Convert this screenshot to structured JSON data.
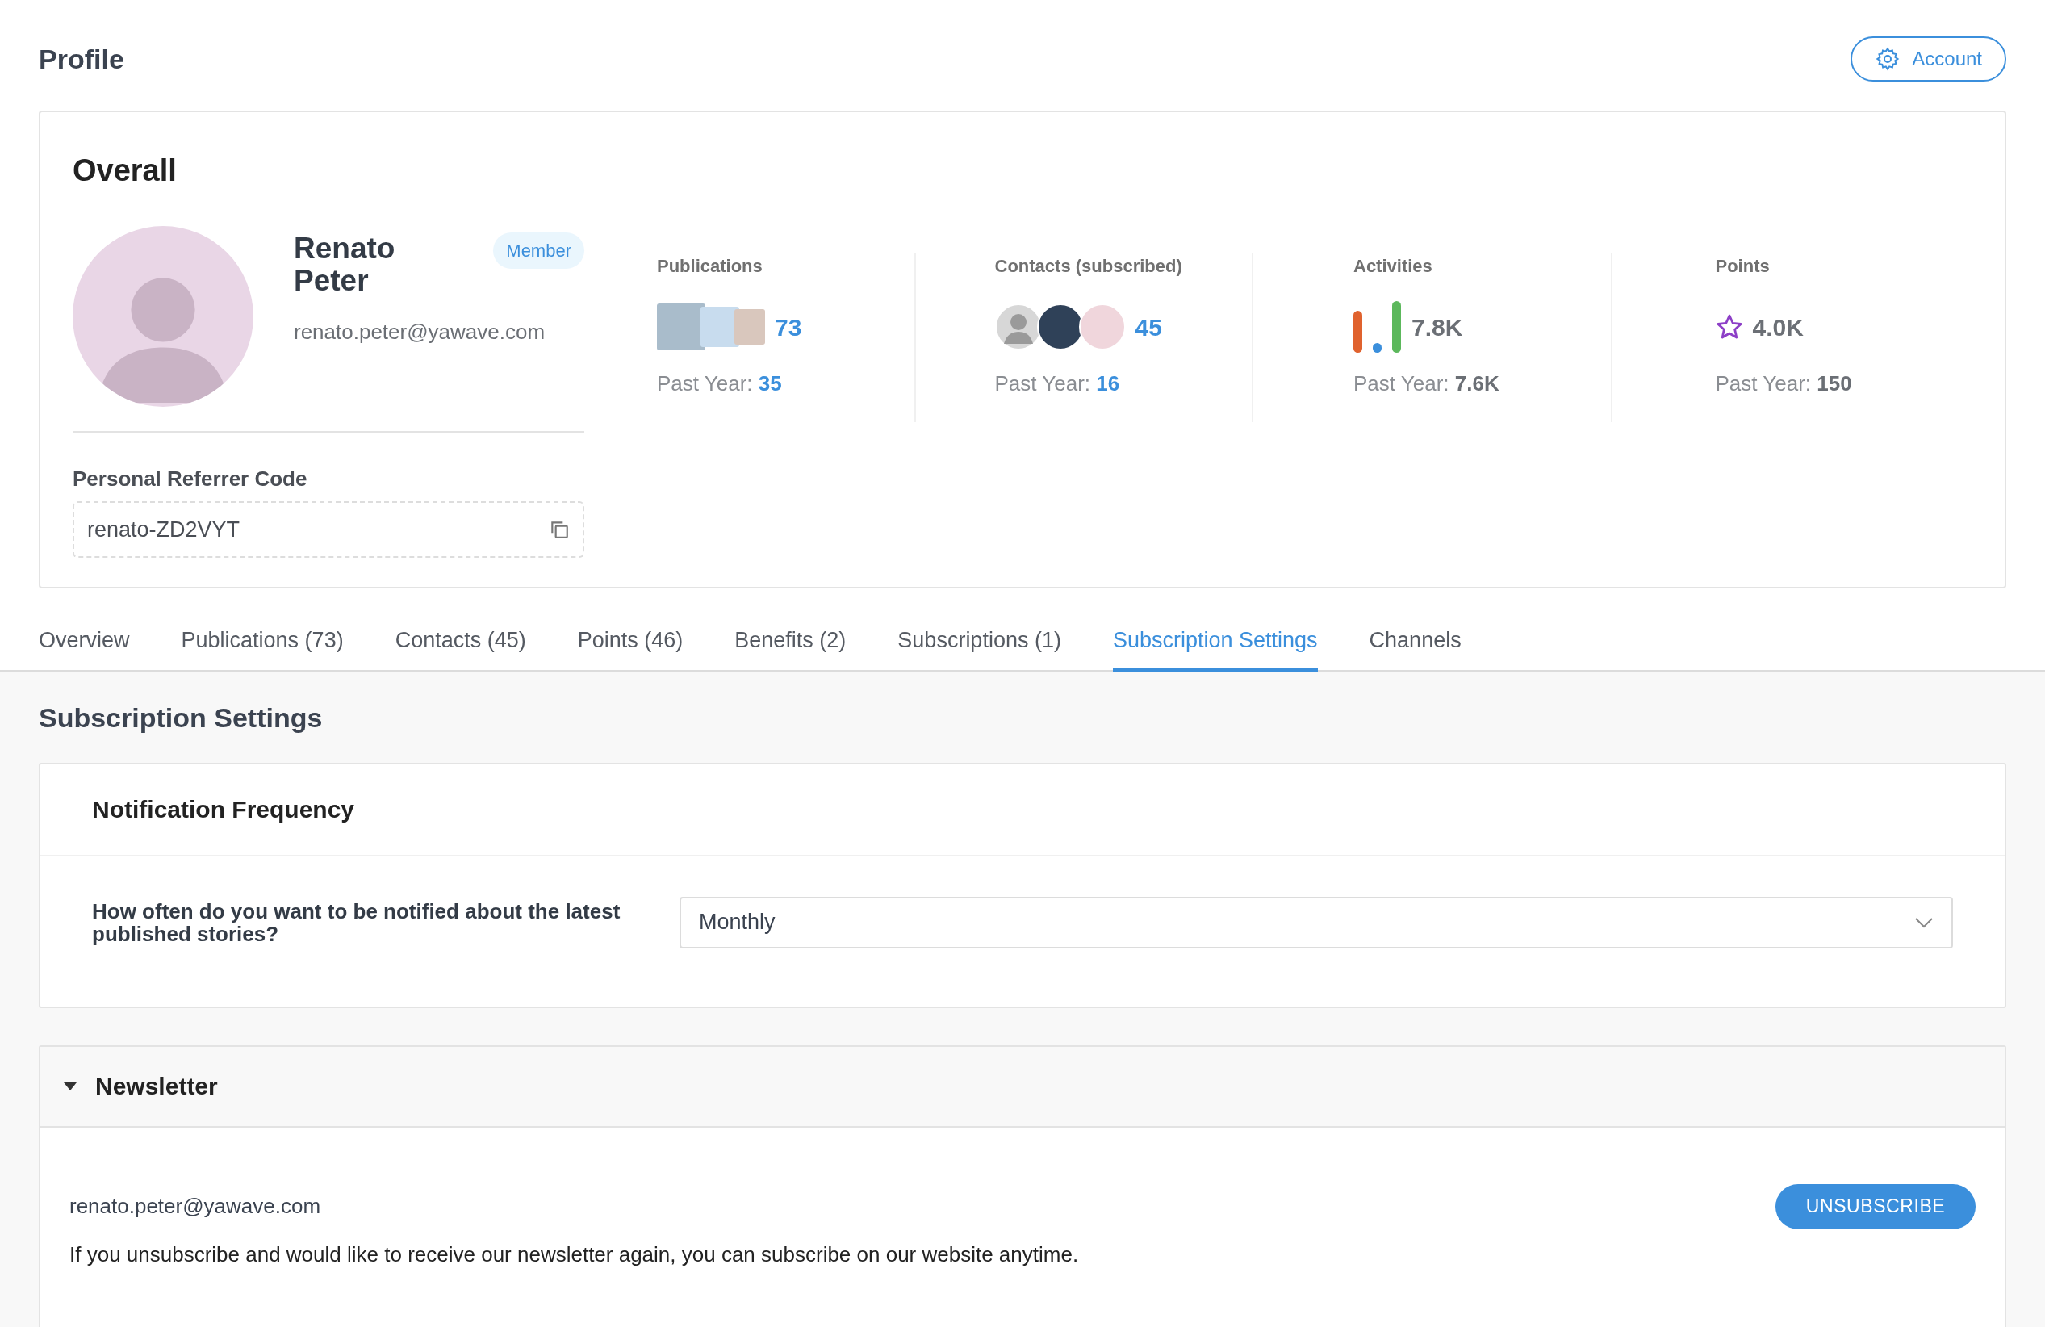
{
  "page_title": "Profile",
  "account_button": {
    "label": "Account"
  },
  "overall": {
    "title": "Overall",
    "profile": {
      "name": "Renato Peter",
      "badge": "Member",
      "email": "renato.peter@yawave.com"
    },
    "referrer_code": {
      "label": "Personal Referrer Code",
      "value": "renato-ZD2VYT"
    },
    "stats": [
      {
        "kind": "publications",
        "label": "Publications",
        "value": "73",
        "past_year_label": "Past Year:",
        "past_year_value": "35"
      },
      {
        "kind": "contacts",
        "label": "Contacts (subscribed)",
        "value": "45",
        "past_year_label": "Past Year:",
        "past_year_value": "16"
      },
      {
        "kind": "activities",
        "label": "Activities",
        "value": "7.8K",
        "past_year_label": "Past Year:",
        "past_year_value": "7.6K"
      },
      {
        "kind": "points",
        "label": "Points",
        "value": "4.0K",
        "past_year_label": "Past Year:",
        "past_year_value": "150"
      }
    ]
  },
  "tabs": [
    {
      "label": "Overview",
      "selected": false
    },
    {
      "label": "Publications (73)",
      "selected": false
    },
    {
      "label": "Contacts (45)",
      "selected": false
    },
    {
      "label": "Points (46)",
      "selected": false
    },
    {
      "label": "Benefits (2)",
      "selected": false
    },
    {
      "label": "Subscriptions (1)",
      "selected": false
    },
    {
      "label": "Subscription Settings",
      "selected": true
    },
    {
      "label": "Channels",
      "selected": false
    }
  ],
  "section_title": "Subscription Settings",
  "notification_frequency": {
    "title": "Notification Frequency",
    "question": "How often do you want to be notified about the latest published stories?",
    "value": "Monthly"
  },
  "newsletter": {
    "title": "Newsletter",
    "expanded": true,
    "email": "renato.peter@yawave.com",
    "button": "UNSUBSCRIBE",
    "note": "If you unsubscribe and would like to receive our newsletter again, you can subscribe on our website anytime."
  }
}
